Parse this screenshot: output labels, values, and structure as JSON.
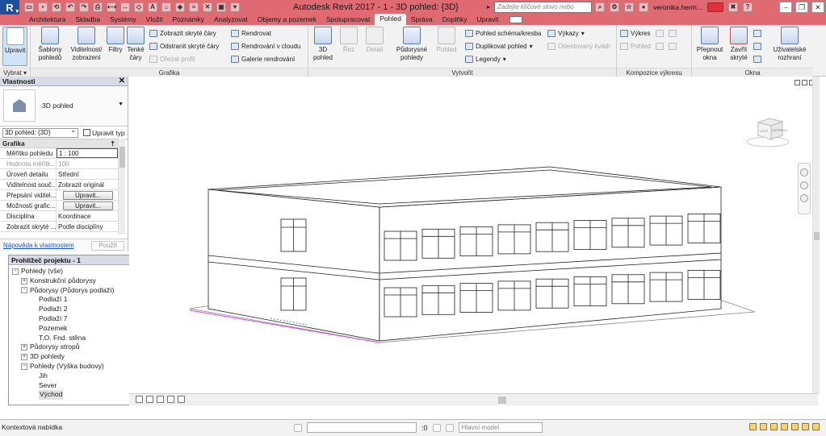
{
  "app": {
    "logo": "R",
    "title": "Autodesk Revit 2017 -       1 - 3D pohled: {3D}",
    "search_placeholder": "Zadejte klíčové slovo nebo výraz.",
    "username": "veronika.herm...",
    "titlebar_color": "#df6a72"
  },
  "tabs": [
    "Architektura",
    "Sklad­ba",
    "Systémy",
    "Vložit",
    "Poznámky",
    "Analyzovat",
    "Objemy a pozemek",
    "Spolupracovat",
    "Pohled",
    "Správa",
    "Doplňky",
    "Upravit"
  ],
  "ribbon": {
    "select": {
      "label": "Upravit",
      "panel": "Vybrat"
    },
    "grafika": {
      "panel": "Grafika",
      "templates": "Šablony pohledů",
      "visibility": "Viditelnost/ zobrazení",
      "filters": "Filtry",
      "thin_lines": "Tenké čáry",
      "show_hidden": "Zobrazit skryté čáry",
      "remove_hidden": "Odstranit skryté čáry",
      "cut_profile": "Ořezat profil",
      "render": "Rendrovat",
      "render_cloud": "Rendrování v cloudu",
      "gallery": "Galerie rendrování"
    },
    "vytvorit": {
      "panel": "Vytvořit",
      "view3d": "3D pohled",
      "section": "Řez",
      "detail": "Detail",
      "plan": "Půdorysné pohledy",
      "elevation": "Pohled",
      "schema": "Pohled schéma/kresba",
      "duplicate": "Duplikovat pohled",
      "legends": "Legendy",
      "schedules": "Výkazy",
      "oriented_box": "Orientovaný kvádr"
    },
    "kompozice": {
      "panel": "Kompozice výkresu",
      "sheet": "Výkres",
      "view": "Pohled"
    },
    "okna": {
      "panel": "Okna",
      "switch": "Přepnout okna",
      "close_hidden": "Zavřít skryté",
      "ui": "Uživatelské rozhraní"
    }
  },
  "properties": {
    "title": "Vlastnosti",
    "type_name": "3D pohled",
    "instance": "3D pohled: {3D}",
    "edit_type": "Upravit typ",
    "group": "Grafika",
    "rows": [
      {
        "k": "Měřítko pohledu",
        "v": "1 : 100",
        "kind": "input"
      },
      {
        "k": "Hodnota měřítk...",
        "v": "100",
        "kind": "dis"
      },
      {
        "k": "Úroveň detailu",
        "v": "Střední",
        "kind": "text"
      },
      {
        "k": "Viditelnost souč...",
        "v": "Zobrazit originál",
        "kind": "text"
      },
      {
        "k": "Přepsání viditel...",
        "v": "Upravit...",
        "kind": "btn"
      },
      {
        "k": "Možnosti grafic...",
        "v": "Upravit...",
        "kind": "btn"
      },
      {
        "k": "Disciplína",
        "v": "Koordinace",
        "kind": "text"
      },
      {
        "k": "Zobrazit skryté ...",
        "v": "Podle disciplíny",
        "kind": "text"
      }
    ],
    "help_link": "Nápověda k vlastnostem",
    "apply": "Použít"
  },
  "browser": {
    "title": "Prohlížeč projektu - 1",
    "items": [
      {
        "label": "Pohledy (vše)",
        "level": 0,
        "exp": "-"
      },
      {
        "label": "Konstrukční půdorysy",
        "level": 1,
        "exp": "+"
      },
      {
        "label": "Půdorysy (Půdorys podlaží)",
        "level": 1,
        "exp": "-"
      },
      {
        "label": "Podlaží 1",
        "level": 2,
        "exp": ""
      },
      {
        "label": "Podlaží 2",
        "level": 2,
        "exp": ""
      },
      {
        "label": "Podlaží 7",
        "level": 2,
        "exp": ""
      },
      {
        "label": "Pozemek",
        "level": 2,
        "exp": ""
      },
      {
        "label": "T.O. Fnd. stěna",
        "level": 2,
        "exp": ""
      },
      {
        "label": "Půdorysy stropů",
        "level": 1,
        "exp": "+"
      },
      {
        "label": "3D pohledy",
        "level": 1,
        "exp": "+"
      },
      {
        "label": "Pohledy (Výška budovy)",
        "level": 1,
        "exp": "-"
      },
      {
        "label": "Jih",
        "level": 2,
        "exp": ""
      },
      {
        "label": "Sever",
        "level": 2,
        "exp": ""
      },
      {
        "label": "Východ",
        "level": 2,
        "exp": "",
        "selected": true
      }
    ]
  },
  "viewcube": {
    "face_left": "LEVÝ",
    "face_right": "ZEPŘEDU"
  },
  "statusbar": {
    "text": "Kontextová nabídka",
    "coord": ":0",
    "model": "Hlavní model"
  }
}
